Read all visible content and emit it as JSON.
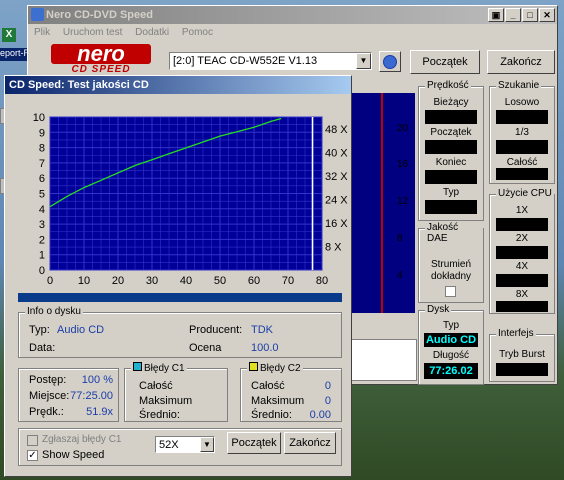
{
  "desktop": {
    "icon_label": "eport-R"
  },
  "main_window": {
    "title": "Nero CD-DVD Speed",
    "menu": [
      "Plik",
      "Uruchom test",
      "Dodatki",
      "Pomoc"
    ],
    "logo_top": "nero",
    "logo_bottom": "CD SPEED",
    "drive": "[2:0]  TEAC CD-W552E V1.13",
    "start_button": "Początek",
    "end_button": "Zakończ",
    "bg_chart_ticks": [
      "20",
      "16",
      "12",
      "8",
      "4"
    ],
    "panels": {
      "speed": {
        "title": "Prędkość",
        "labels": [
          "Bieżący",
          "Początek",
          "Koniec",
          "Typ"
        ],
        "values": [
          "",
          "",
          "",
          ""
        ]
      },
      "search": {
        "title": "Szukanie",
        "labels": [
          "Losowo",
          "1/3",
          "Całość"
        ],
        "values": [
          "",
          "",
          ""
        ]
      },
      "cpu": {
        "title": "Użycie CPU",
        "labels": [
          "1X",
          "2X",
          "4X",
          "8X"
        ],
        "values": [
          "",
          "",
          "",
          ""
        ]
      },
      "dae": {
        "title": "Jakość DAE",
        "labels": [
          "Strumień",
          "dokładny"
        ],
        "checked": false
      },
      "disc": {
        "title": "Dysk",
        "type_label": "Typ",
        "type_value": "Audio CD",
        "length_label": "Długość",
        "length_value": "77:26.02"
      },
      "interface": {
        "title": "Interfejs",
        "burst_label": "Tryb Burst"
      }
    }
  },
  "child_window": {
    "title": "CD Speed: Test jakości CD",
    "chart_data": {
      "type": "line",
      "x_ticks": [
        "0",
        "10",
        "20",
        "30",
        "40",
        "50",
        "60",
        "70",
        "80"
      ],
      "y_left_ticks": [
        "10",
        "9",
        "8",
        "7",
        "6",
        "5",
        "4",
        "3",
        "2",
        "1",
        "0"
      ],
      "y_right_ticks": [
        "48 X",
        "40 X",
        "32 X",
        "24 X",
        "16 X",
        "8 X"
      ],
      "xlim": [
        0,
        80
      ],
      "ylim_left": [
        0,
        10
      ],
      "ylim_right": [
        0,
        52
      ],
      "grid": true,
      "background": "#000099",
      "gridcolor": "#3333cc",
      "series": [
        {
          "color": "#22dd22",
          "axis": "right",
          "x": [
            0,
            5,
            10,
            15,
            20,
            25,
            30,
            35,
            40,
            45,
            50,
            55,
            60,
            65,
            68
          ],
          "y": [
            21.5,
            25,
            28,
            30.5,
            33,
            35.5,
            37.5,
            39.5,
            41.5,
            43.5,
            45.5,
            47,
            48.5,
            50.5,
            51.5
          ]
        }
      ],
      "marker_x": 77.2
    },
    "disc_info": {
      "title": "Info o dysku",
      "type_label": "Typ:",
      "type_value": "Audio CD",
      "date_label": "Data:",
      "date_value": "",
      "producer_label": "Producent:",
      "producer_value": "TDK",
      "rating_label": "Ocena",
      "rating_value": "100.0"
    },
    "progress": {
      "progress_label": "Postęp:",
      "progress_value": "100 %",
      "position_label": "Miejsce:",
      "position_value": "77:25.00",
      "speed_label": "Prędk.:",
      "speed_value": "51.9x"
    },
    "c1": {
      "title": "Błędy C1",
      "total_label": "Całość",
      "total_value": "",
      "max_label": "Maksimum",
      "max_value": "",
      "avg_label": "Średnio:",
      "avg_value": ""
    },
    "c2": {
      "title": "Błędy C2",
      "total_label": "Całość",
      "total_value": "0",
      "max_label": "Maksimum",
      "max_value": "0",
      "avg_label": "Średnio:",
      "avg_value": "0.00"
    },
    "options": {
      "report_c1_label": "Zgłaszaj błędy C1",
      "report_c1_checked": false,
      "show_speed_label": "Show Speed",
      "show_speed_checked": true,
      "speed_select": "52X",
      "start_button": "Początek",
      "end_button": "Zakończ"
    }
  }
}
